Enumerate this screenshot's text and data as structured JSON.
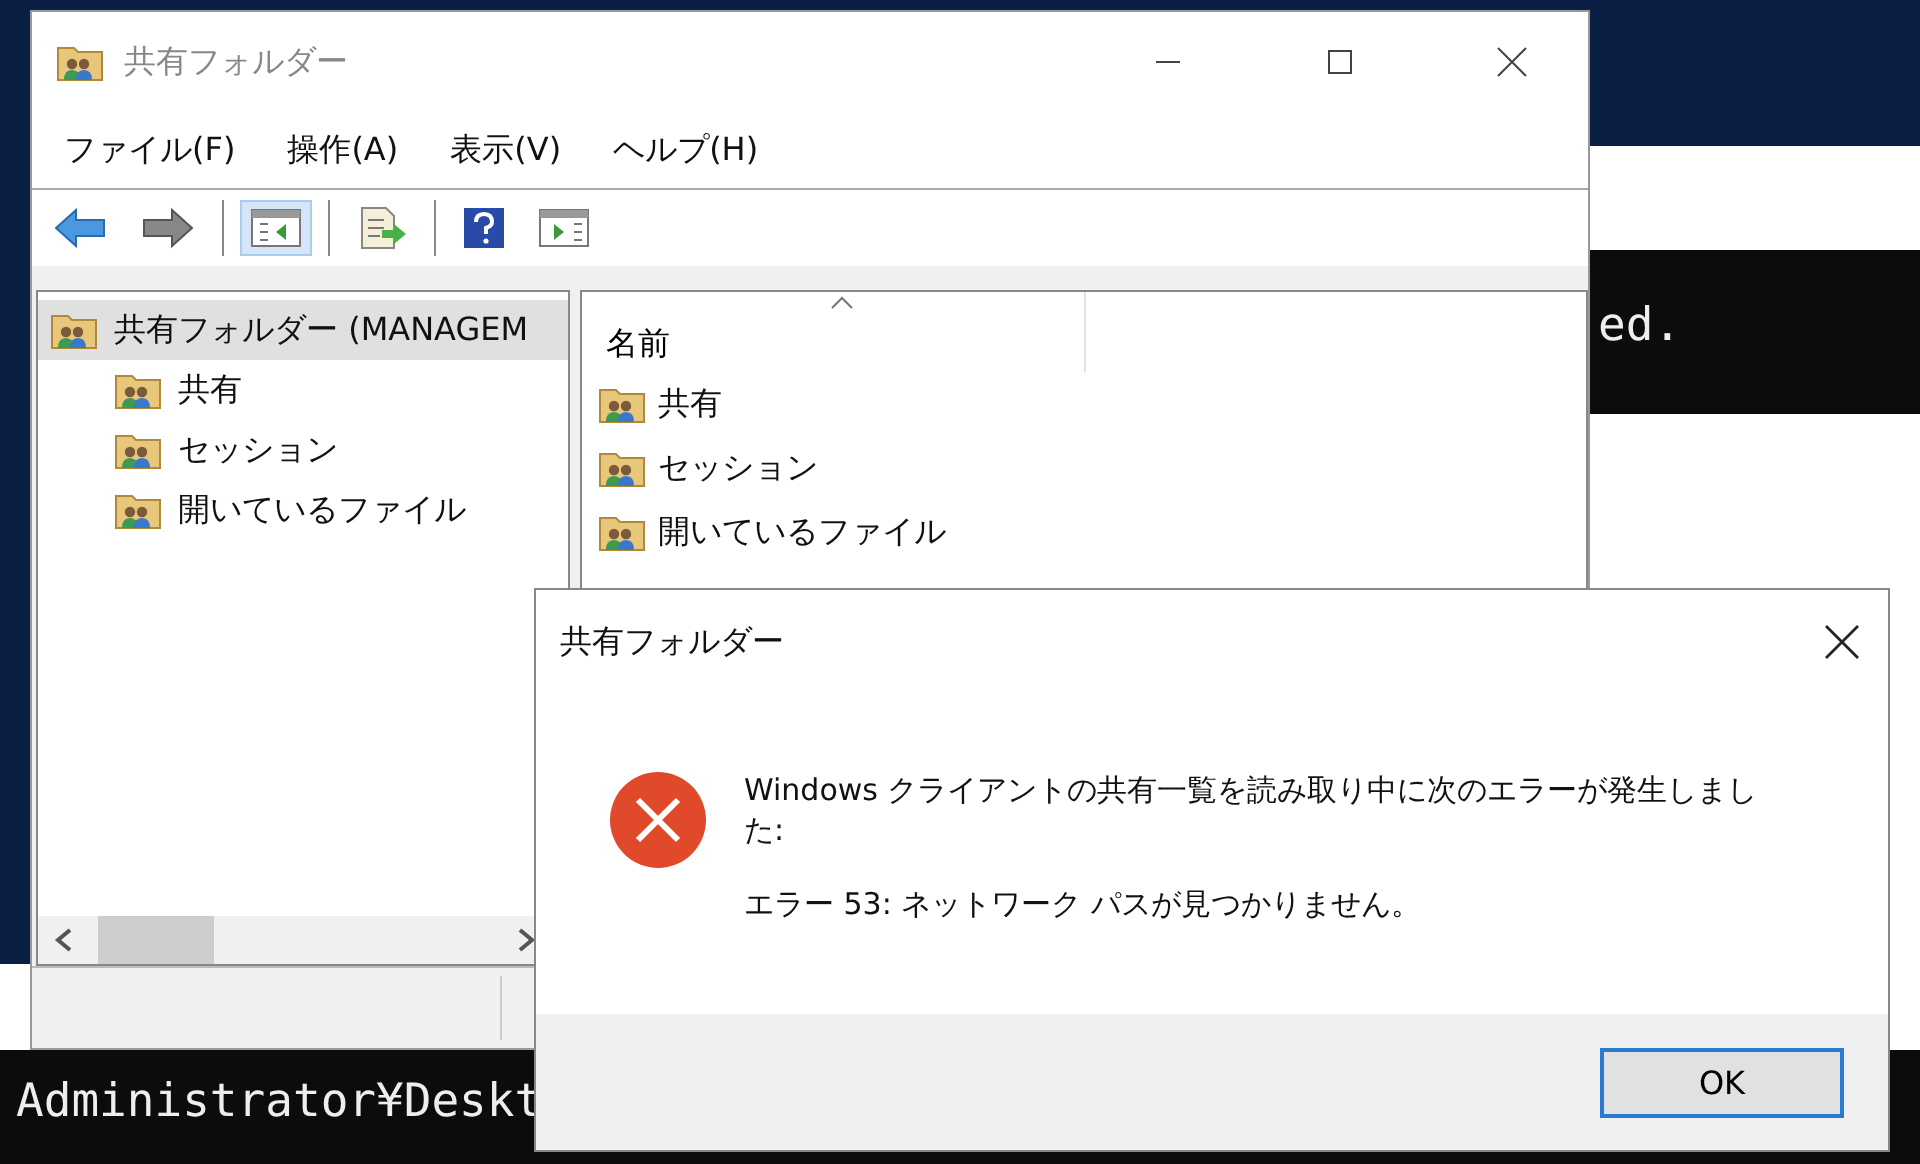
{
  "background": {
    "console_top": "ed.",
    "console_bottom": "Administrator¥Deskt"
  },
  "window": {
    "title": "共有フォルダー",
    "menu": [
      "ファイル(F)",
      "操作(A)",
      "表示(V)",
      "ヘルプ(H)"
    ],
    "toolbar": [
      [
        {
          "kind": "back",
          "pressed": false
        },
        {
          "kind": "forward",
          "pressed": false
        }
      ],
      [
        {
          "kind": "tree",
          "pressed": true
        }
      ],
      [
        {
          "kind": "export",
          "pressed": false
        }
      ],
      [
        {
          "kind": "help",
          "pressed": false
        },
        {
          "kind": "pane",
          "pressed": false
        }
      ]
    ],
    "tree": {
      "label": "共有フォルダー (MANAGEM",
      "selected": true,
      "children": [
        {
          "label": "共有",
          "selected": false
        },
        {
          "label": "セッション",
          "selected": false
        },
        {
          "label": "開いているファイル",
          "selected": false
        }
      ]
    },
    "list": {
      "column": "名前",
      "sorted": true,
      "items": [
        "共有",
        "セッション",
        "開いているファイル"
      ]
    }
  },
  "dialog": {
    "title": "共有フォルダー",
    "message": "Windows クライアントの共有一覧を読み取り中に次のエラーが発生しました:",
    "error": "エラー 53: ネットワーク パスが見つかりません。",
    "button": "OK"
  }
}
